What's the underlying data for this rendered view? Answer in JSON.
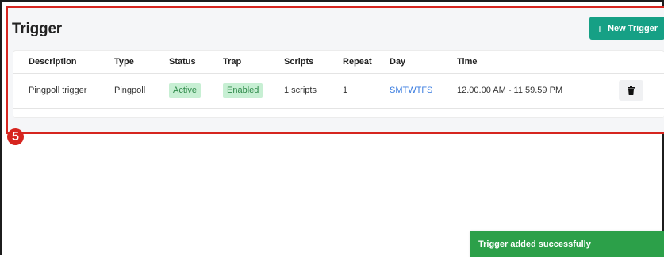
{
  "header": {
    "title": "Trigger",
    "new_button_icon": "+",
    "new_button_label": "New Trigger"
  },
  "table": {
    "columns": [
      "Description",
      "Type",
      "Status",
      "Trap",
      "Scripts",
      "Repeat",
      "Day",
      "Time"
    ],
    "rows": [
      {
        "description": "Pingpoll trigger",
        "type": "Pingpoll",
        "status": "Active",
        "trap": "Enabled",
        "scripts": "1 scripts",
        "repeat": "1",
        "day": "SMTWTFS",
        "time": "12.00.00 AM - 11.59.59 PM",
        "action_icon": "trash-icon"
      }
    ]
  },
  "annotation": {
    "step_number": "5"
  },
  "toast": {
    "message": "Trigger added successfully"
  },
  "colors": {
    "accent": "#16a085",
    "annotation_red": "#d6251f",
    "toast_green": "#2ca049",
    "pill_bg": "#c7efd3",
    "pill_text": "#2f8a4a",
    "link_blue": "#3b7de0"
  }
}
